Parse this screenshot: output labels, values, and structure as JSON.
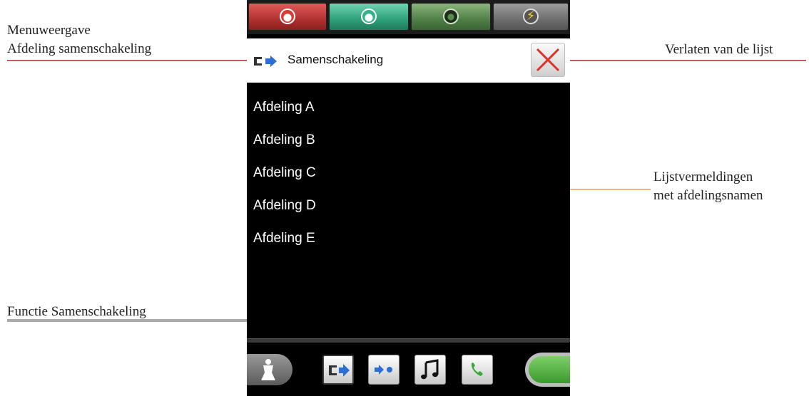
{
  "annotations": {
    "menu_display_line1": "Menuweergave",
    "menu_display_line2": "Afdeling samenschakeling",
    "exit_list": "Verlaten van de lijst",
    "list_entries_line1": "Lijstvermeldingen",
    "list_entries_line2": "met afdelingsnamen",
    "function_merge": "Functie Samenschakeling"
  },
  "header": {
    "title": "Samenschakeling",
    "icon": "merge-arrow-icon",
    "close_icon": "close-x-icon"
  },
  "list": {
    "items": [
      "Afdeling A",
      "Afdeling B",
      "Afdeling C",
      "Afdeling D",
      "Afdeling E"
    ]
  },
  "top_buttons": [
    {
      "name": "red-alarm-button",
      "color": "#d93a36"
    },
    {
      "name": "teal-status-button",
      "color": "#2fb387"
    },
    {
      "name": "green-status-button",
      "color": "#507f47"
    },
    {
      "name": "lightning-button",
      "color": "#f7d21b"
    }
  ],
  "bottom_buttons": [
    {
      "name": "person-icon"
    },
    {
      "name": "merge-function-icon"
    },
    {
      "name": "forward-dot-icon"
    },
    {
      "name": "music-note-icon"
    },
    {
      "name": "phone-icon"
    },
    {
      "name": "green-pill-toggle"
    }
  ],
  "colors": {
    "annotation_line_red": "#b5202a",
    "annotation_line_orange": "#f0a050",
    "accent_blue": "#2b6fd6",
    "close_red": "#e0302a",
    "phone_green": "#39a935"
  }
}
